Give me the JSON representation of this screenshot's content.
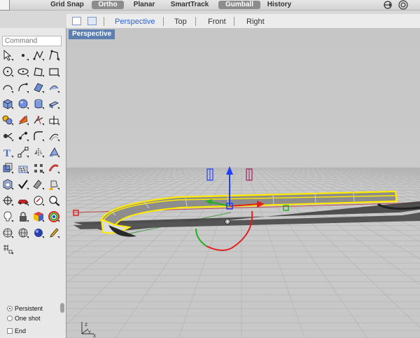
{
  "toolbar": {
    "items": [
      {
        "label": "Grid Snap",
        "active": false
      },
      {
        "label": "Ortho",
        "active": true
      },
      {
        "label": "Planar",
        "active": false
      },
      {
        "label": "SmartTrack",
        "active": false
      },
      {
        "label": "Gumball",
        "active": true
      },
      {
        "label": "History",
        "active": false
      }
    ],
    "right_icons": [
      "filter-icon",
      "target-icon"
    ]
  },
  "command": {
    "placeholder": "Command"
  },
  "tools": [
    "select-arrow-icon",
    "point-icon",
    "curve-icon",
    "polyline-icon",
    "circle-icon",
    "ellipse-icon",
    "polygon-icon",
    "rectangle-icon",
    "arc-icon",
    "freeform-icon",
    "surface-icon",
    "loft-icon",
    "box-icon",
    "sphere-icon",
    "cylinder-icon",
    "extrude-icon",
    "boolean-icon",
    "gumball-icon",
    "trim-icon",
    "split-icon",
    "explode-icon",
    "join-icon",
    "fillet-icon",
    "offset-icon",
    "text-icon",
    "dimension-icon",
    "mirror-icon",
    "scale-icon",
    "array-icon",
    "mesh-icon",
    "grid-icon",
    "pipe-icon",
    "material-icon",
    "check-icon",
    "paint-icon",
    "paint-bucket-icon",
    "move-icon",
    "car-icon",
    "analyze-icon",
    "zoom-icon",
    "light-icon",
    "lock-icon",
    "render-icon",
    "color-wheel-icon",
    "grid-sphere-icon",
    "globe-icon",
    "blue-sphere-icon",
    "eyedropper-icon",
    "snap-grid-icon"
  ],
  "options": {
    "persistent": "Persistent",
    "one_shot": "One shot",
    "end": "End"
  },
  "view_tabs": [
    {
      "label": "Perspective",
      "active": true
    },
    {
      "label": "Top",
      "active": false
    },
    {
      "label": "Front",
      "active": false
    },
    {
      "label": "Right",
      "active": false
    }
  ],
  "viewport": {
    "label": "Perspective",
    "axis_labels": {
      "z": "z",
      "y": "y",
      "x": "x"
    }
  },
  "colors": {
    "selection": "#ffea00",
    "gumball_x": "#e02020",
    "gumball_y": "#22b022",
    "gumball_z": "#1f3fff",
    "viewport_label_bg": "#5a7fb0",
    "active_tab": "#2a62d6"
  }
}
